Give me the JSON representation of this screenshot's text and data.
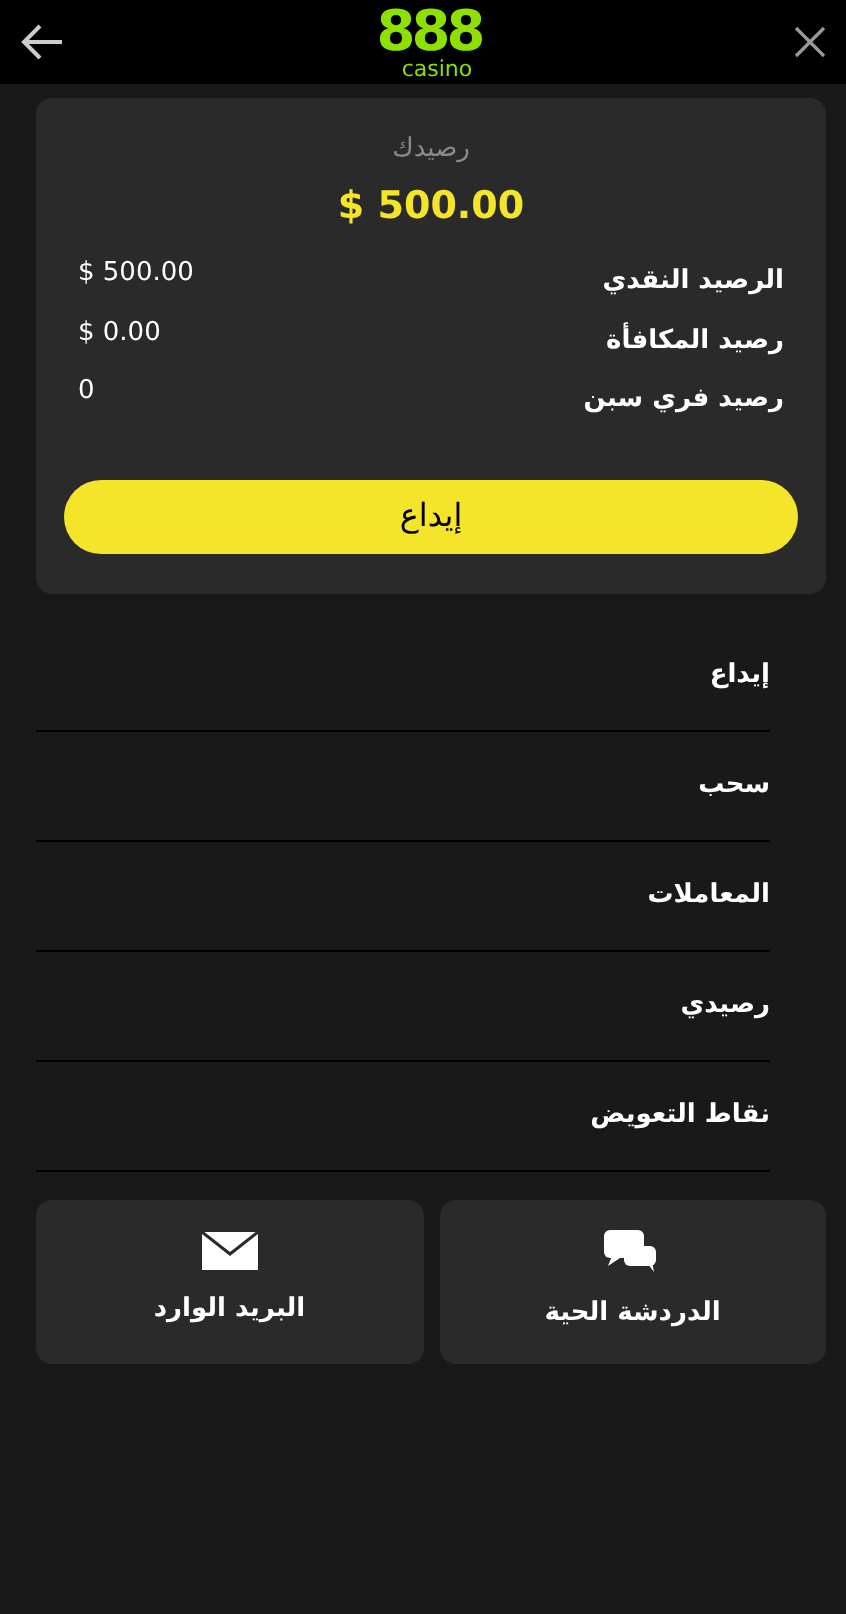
{
  "header": {
    "logo": {
      "digits": "888",
      "word": "casino"
    }
  },
  "balance_card": {
    "title": "رصيدك",
    "total": "$ 500.00",
    "rows": [
      {
        "label": "الرصيد النقدي",
        "value": "$ 500.00"
      },
      {
        "label": "رصيد المكافأة",
        "value": "$ 0.00"
      },
      {
        "label": "رصيد فري سبن",
        "value": "0"
      }
    ],
    "button": "إيداع"
  },
  "menu": [
    "إيداع",
    "سحب",
    "المعاملات",
    "رصيدي",
    "نقاط التعويض"
  ],
  "actions": [
    {
      "kind": "chat",
      "label": "الدردشة الحية"
    },
    {
      "kind": "mail",
      "label": "البريد الوارد"
    }
  ]
}
